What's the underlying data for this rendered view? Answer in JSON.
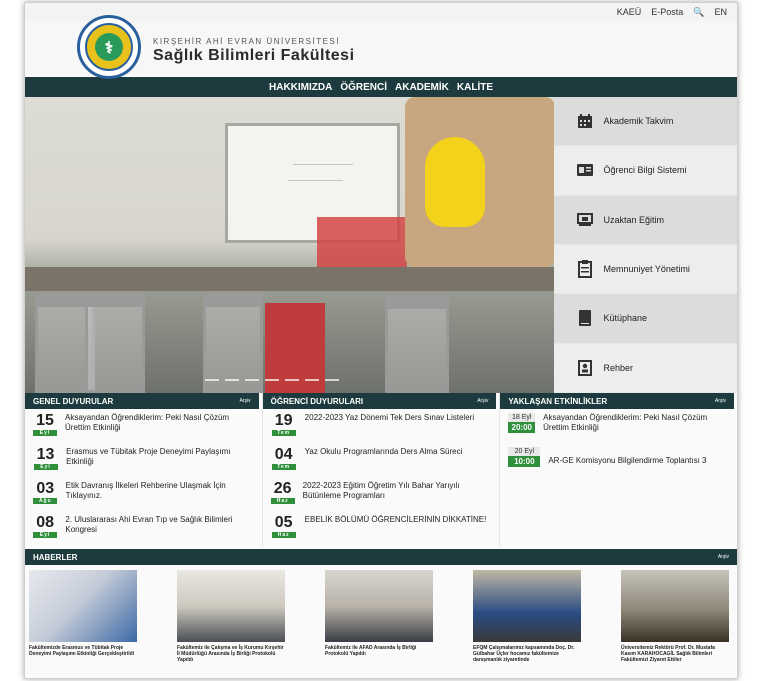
{
  "topbar": {
    "kaeu": "KAEÜ",
    "eposta": "E-Posta",
    "en": "EN"
  },
  "header": {
    "university": "KIRŞEHİR AHİ EVRAN ÜNİVERSİTESİ",
    "faculty": "Sağlık Bilimleri Fakültesi"
  },
  "nav": [
    "HAKKIMIZDA",
    "ÖĞRENCİ",
    "AKADEMİK",
    "KALİTE"
  ],
  "quick_links": [
    {
      "label": "Akademik Takvim",
      "icon": "calendar-icon"
    },
    {
      "label": "Öğrenci Bilgi Sistemi",
      "icon": "id-card-icon"
    },
    {
      "label": "Uzaktan Eğitim",
      "icon": "presentation-icon"
    },
    {
      "label": "Memnuniyet Yönetimi",
      "icon": "clipboard-icon"
    },
    {
      "label": "Kütüphane",
      "icon": "book-icon"
    },
    {
      "label": "Rehber",
      "icon": "contacts-icon"
    }
  ],
  "genel": {
    "title": "GENEL DUYURULAR",
    "arsiv": "Arşiv",
    "items": [
      {
        "day": "15",
        "month": "Eyl",
        "text": "Aksayandan Öğrendiklerim: Peki Nasıl Çözüm Ürettim Etkinliği"
      },
      {
        "day": "13",
        "month": "Eyl",
        "text": "Erasmus ve Tübitak Proje Deneyimi Paylaşımı Etkinliği"
      },
      {
        "day": "03",
        "month": "Ağu",
        "text": "Etik Davranış İlkeleri Rehberine Ulaşmak İçin Tıklayınız."
      },
      {
        "day": "08",
        "month": "Eyl",
        "text": "2. Uluslararası Ahi Evran Tıp ve Sağlık Bilimleri Kongresi"
      }
    ]
  },
  "ogrenci": {
    "title": "ÖĞRENCİ DUYURULARI",
    "arsiv": "Arşiv",
    "items": [
      {
        "day": "19",
        "month": "Tem",
        "text": "2022-2023 Yaz Dönemi Tek Ders Sınav Listeleri"
      },
      {
        "day": "04",
        "month": "Tem",
        "text": "Yaz Okulu Programlarında Ders Alma Süreci"
      },
      {
        "day": "26",
        "month": "Haz",
        "text": "2022-2023 Eğitim Öğretim Yılı Bahar Yarıyılı Bütünleme Programları"
      },
      {
        "day": "05",
        "month": "Haz",
        "text": "EBELİK BÖLÜMÜ ÖĞRENCİLERİNİN DİKKATİNE!"
      }
    ]
  },
  "etkinlik": {
    "title": "YAKLAŞAN ETKİNLİKLER",
    "arsiv": "Arşiv",
    "items": [
      {
        "date": "18 Eyl",
        "time": "20:00",
        "text": "Aksayandan Öğrendiklerim: Peki Nasıl Çözüm Ürettim Etkinliği"
      },
      {
        "date": "20 Eyl",
        "time": "10:00",
        "text": "AR-GE Komisyonu Bilgilendirme Toplantısı 3"
      }
    ]
  },
  "haberler": {
    "title": "HABERLER",
    "arsiv": "Arşiv",
    "items": [
      {
        "caption": "Fakültemizde Erasmus ve Tübitak Proje Deneyimi Paylaşımı Etkinliği Gerçekleştirildi"
      },
      {
        "caption": "Fakültemiz ile Çalışma ve İş Kurumu Kırşehir İl Müdürlüğü Arasında İş Birliği Protokolü Yapıldı"
      },
      {
        "caption": "Fakültemiz ile AFAD Arasında İş Birliği Protokolü Yapıldı"
      },
      {
        "caption": "EFQM Çalışmalarımız kapsamında Doç. Dr. Gülbahar Üçler hocamız fakültemize danışmanlık ziyaretinde"
      },
      {
        "caption": "Üniversitemiz Rektörü Prof. Dr. Mustafa Kasım KARAHOCAGİL Sağlık Bilimleri Fakültemizi Ziyaret Ettiler"
      }
    ]
  },
  "colors": {
    "nav_bg": "#1d3b3e",
    "accent_green": "#2f8f3a"
  }
}
